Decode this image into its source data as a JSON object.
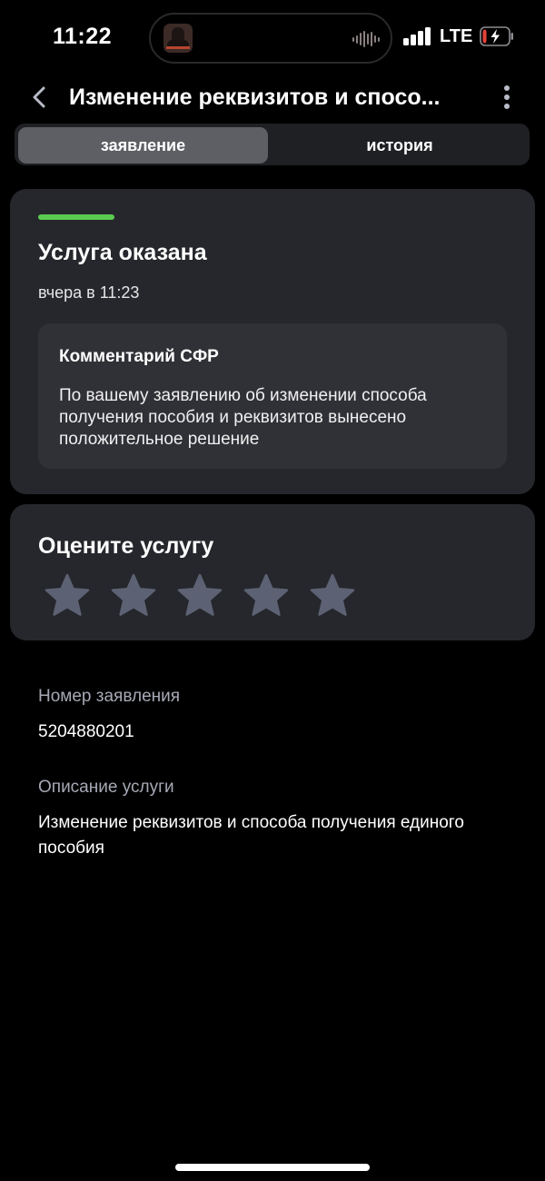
{
  "status_bar": {
    "time": "11:22",
    "network": "LTE",
    "battery_level": 0.15,
    "battery_charging": true,
    "battery_color": "#e5413b"
  },
  "header": {
    "title": "Изменение реквизитов и спосо...",
    "back_icon": "chevron-left-icon",
    "more_icon": "vertical-dots-icon"
  },
  "tabs": [
    {
      "label": "заявление",
      "active": true
    },
    {
      "label": "история",
      "active": false
    }
  ],
  "status_card": {
    "accent_color": "#5acb50",
    "title": "Услуга оказана",
    "date": "вчера в 11:23",
    "comment": {
      "title": "Комментарий СФР",
      "text": "По вашему заявлению об изменении способа получения пособия и реквизитов вынесено положительное решение"
    }
  },
  "rating": {
    "title": "Оцените услугу",
    "max_stars": 5,
    "selected": 0,
    "star_color": "#5c6273"
  },
  "info": {
    "number_label": "Номер заявления",
    "number_value": "5204880201",
    "description_label": "Описание услуги",
    "description_value": "Изменение реквизитов и способа получения единого пособия"
  }
}
